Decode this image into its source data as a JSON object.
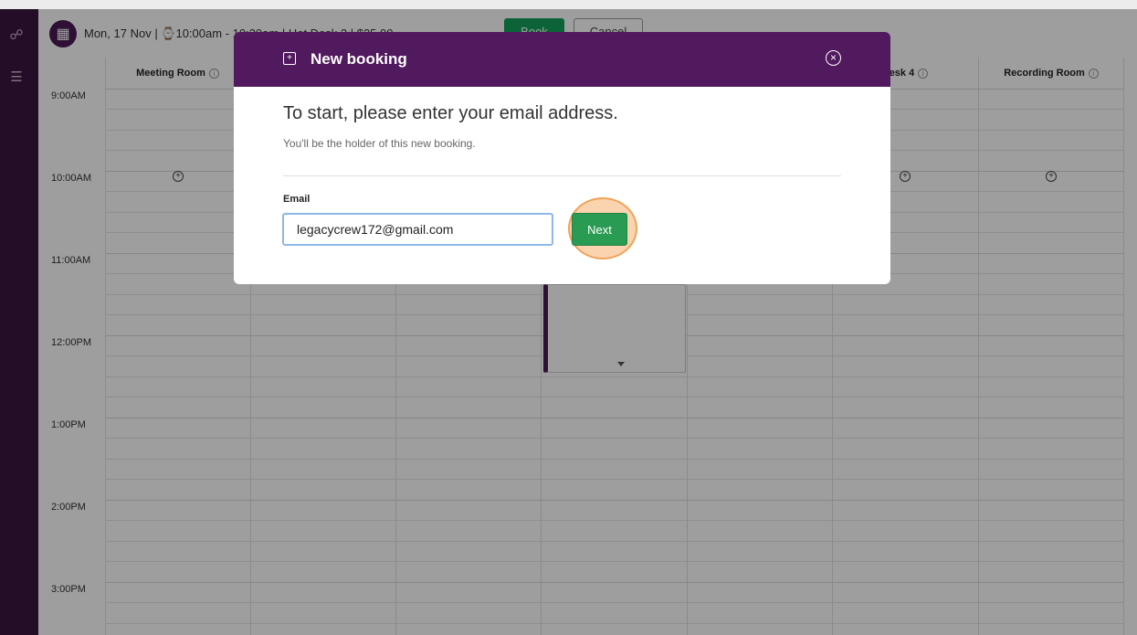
{
  "toolbar": {
    "summary": "Mon, 17 Nov  |  ⌚10:00am - 10:30am  |  Hot Desk 3  |  $25.00",
    "book_label": "Book",
    "cancel_label": "Cancel"
  },
  "calendar": {
    "rooms": [
      "Meeting Room",
      "",
      "",
      "",
      "",
      "Desk 4",
      "Recording Room"
    ],
    "times": [
      "9:00AM",
      "10:00AM",
      "11:00AM",
      "12:00PM",
      "1:00PM",
      "2:00PM",
      "3:00PM"
    ]
  },
  "modal": {
    "title": "New booking",
    "heading": "To start, please enter your email address.",
    "subtext": "You'll be the holder of this new booking.",
    "email_label": "Email",
    "email_value": "legacycrew172@gmail.com",
    "next_label": "Next"
  },
  "colors": {
    "sidebar": "#3b1540",
    "modal_header": "#521a5e",
    "accent_green": "#2a9b53",
    "highlight": "#f0a35a"
  }
}
